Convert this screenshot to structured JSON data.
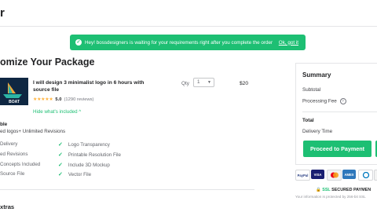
{
  "header": {
    "logo_fragment": "r"
  },
  "toast": {
    "message": "Hey! bossdesigners is waiting for your requirements right after you complete the order",
    "dismiss": "Ok, got it"
  },
  "page_title_fragment": "omize Your Package",
  "gig": {
    "title": "I will design 3 minimalist logo in 6 hours with source file",
    "rating": "5.0",
    "reviews": "(1290 reviews)",
    "stars": "★★★★★",
    "hide_link": "Hide what's included ^",
    "thumb_text": "BOAT",
    "qty_label": "Qty",
    "qty_value": "1",
    "price": "$20"
  },
  "package": {
    "name_fragment": "ble",
    "desc_fragment": "ed logos+ Unlimited Revisions",
    "features_left": [
      "Delivery",
      "ed Revisions",
      "Concepts Included",
      "Source File"
    ],
    "features_right": [
      "Logo Transparency",
      "Printable Resolution File",
      "Include 3D Mockup",
      "Vector File"
    ]
  },
  "extras_fragment": "xtras",
  "summary": {
    "title": "Summary",
    "subtotal": "Subtotal",
    "processing_fee": "Processing Fee",
    "total": "Total",
    "delivery_time": "Delivery Time",
    "proceed": "Proceed to Payment"
  },
  "payments": [
    {
      "label": "PayPal",
      "color": "#253b80"
    },
    {
      "label": "VISA",
      "color": "#1a1f71"
    },
    {
      "label": "MC",
      "color": "#f3f3f3"
    },
    {
      "label": "AMEX",
      "color": "#2e77bb"
    },
    {
      "label": "DC",
      "color": "#0079be"
    },
    {
      "label": "DISC",
      "color": "#f3f3f3"
    }
  ],
  "ssl": {
    "label_ssl": "SSL",
    "label_rest": "SECURED PAYMEN",
    "note": "Your information is protected by 256-bit SSL"
  }
}
